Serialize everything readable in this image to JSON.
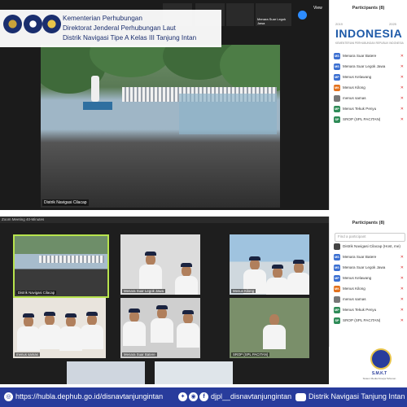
{
  "header": {
    "line1": "Kementerian Perhubungan",
    "line2": "Direktorat Jenderal Perhubungan Laut",
    "line3": "Distrik Navigasi Tipe A Kelas III Tanjung Intan"
  },
  "badge": {
    "word": "INDONESIA",
    "year_start": "2019",
    "year_end": "2025",
    "tagline": "KEMENTERIAN PERHUBUNGAN REPUBLIK INDONESIA"
  },
  "top_window": {
    "view_label": "View",
    "main_label": "Distrik Navigasi Cilacap",
    "thumb_label": "Menara Suar Legok Jawa",
    "participants_title": "Participants (8)",
    "participants": [
      {
        "initials": "MS",
        "name": "Menara Suar Batere",
        "color": "#3b6fd1"
      },
      {
        "initials": "MS",
        "name": "Menara Suar Legok Jawa",
        "color": "#3b6fd1"
      },
      {
        "initials": "MP",
        "name": "Menus Kelawang",
        "color": "#3b6fd1"
      },
      {
        "initials": "MK",
        "name": "Menus Kilong",
        "color": "#e2711d"
      },
      {
        "initials": "",
        "name": "menus samas",
        "color": "#777777"
      },
      {
        "initials": "MP",
        "name": "Menus Tekuk Penyu",
        "color": "#2e8b57"
      },
      {
        "initials": "SP",
        "name": "SROP (SPL PACITAN)",
        "color": "#2e8b57"
      }
    ]
  },
  "bottom_window": {
    "meeting_label": "Zoom Meeting 40-Minutes",
    "participants_title": "Participants (8)",
    "search_placeholder": "Find a participant",
    "participants": [
      {
        "initials": "",
        "name": "Distrik Navigasi Cilacap (Host, me)",
        "color": "#444444"
      },
      {
        "initials": "MS",
        "name": "Menara Suar Batere",
        "color": "#3b6fd1"
      },
      {
        "initials": "MS",
        "name": "Menara Suar Legok Jawa",
        "color": "#3b6fd1"
      },
      {
        "initials": "MP",
        "name": "Menus Kelawang",
        "color": "#3b6fd1"
      },
      {
        "initials": "MK",
        "name": "Menus Kilong",
        "color": "#e2711d"
      },
      {
        "initials": "",
        "name": "menus samas",
        "color": "#777777"
      },
      {
        "initials": "MP",
        "name": "Menus Tekuk Penyu",
        "color": "#2e8b57"
      },
      {
        "initials": "SP",
        "name": "SROP (SPL PACITAN)",
        "color": "#2e8b57"
      }
    ],
    "tiles": [
      {
        "label": "Distrik Navigasi Cilacap"
      },
      {
        "label": "Menara Suar Legok Jawa"
      },
      {
        "label": "Menus Kilong"
      },
      {
        "label": "menus samas"
      },
      {
        "label": "Menara Suar Batere"
      },
      {
        "label": "SROP (SPL PACITAN)"
      }
    ]
  },
  "footer": {
    "url": "https://hubla.dephub.go.id/disnavtanjungintan",
    "social": "djpl__disnavtanjungintan",
    "youtube": "Distrik Navigasi Tanjung Intan"
  },
  "smkt": {
    "title": "S.M.K.T",
    "subtitle": "Sistem Media Kinerja Tahunan"
  }
}
